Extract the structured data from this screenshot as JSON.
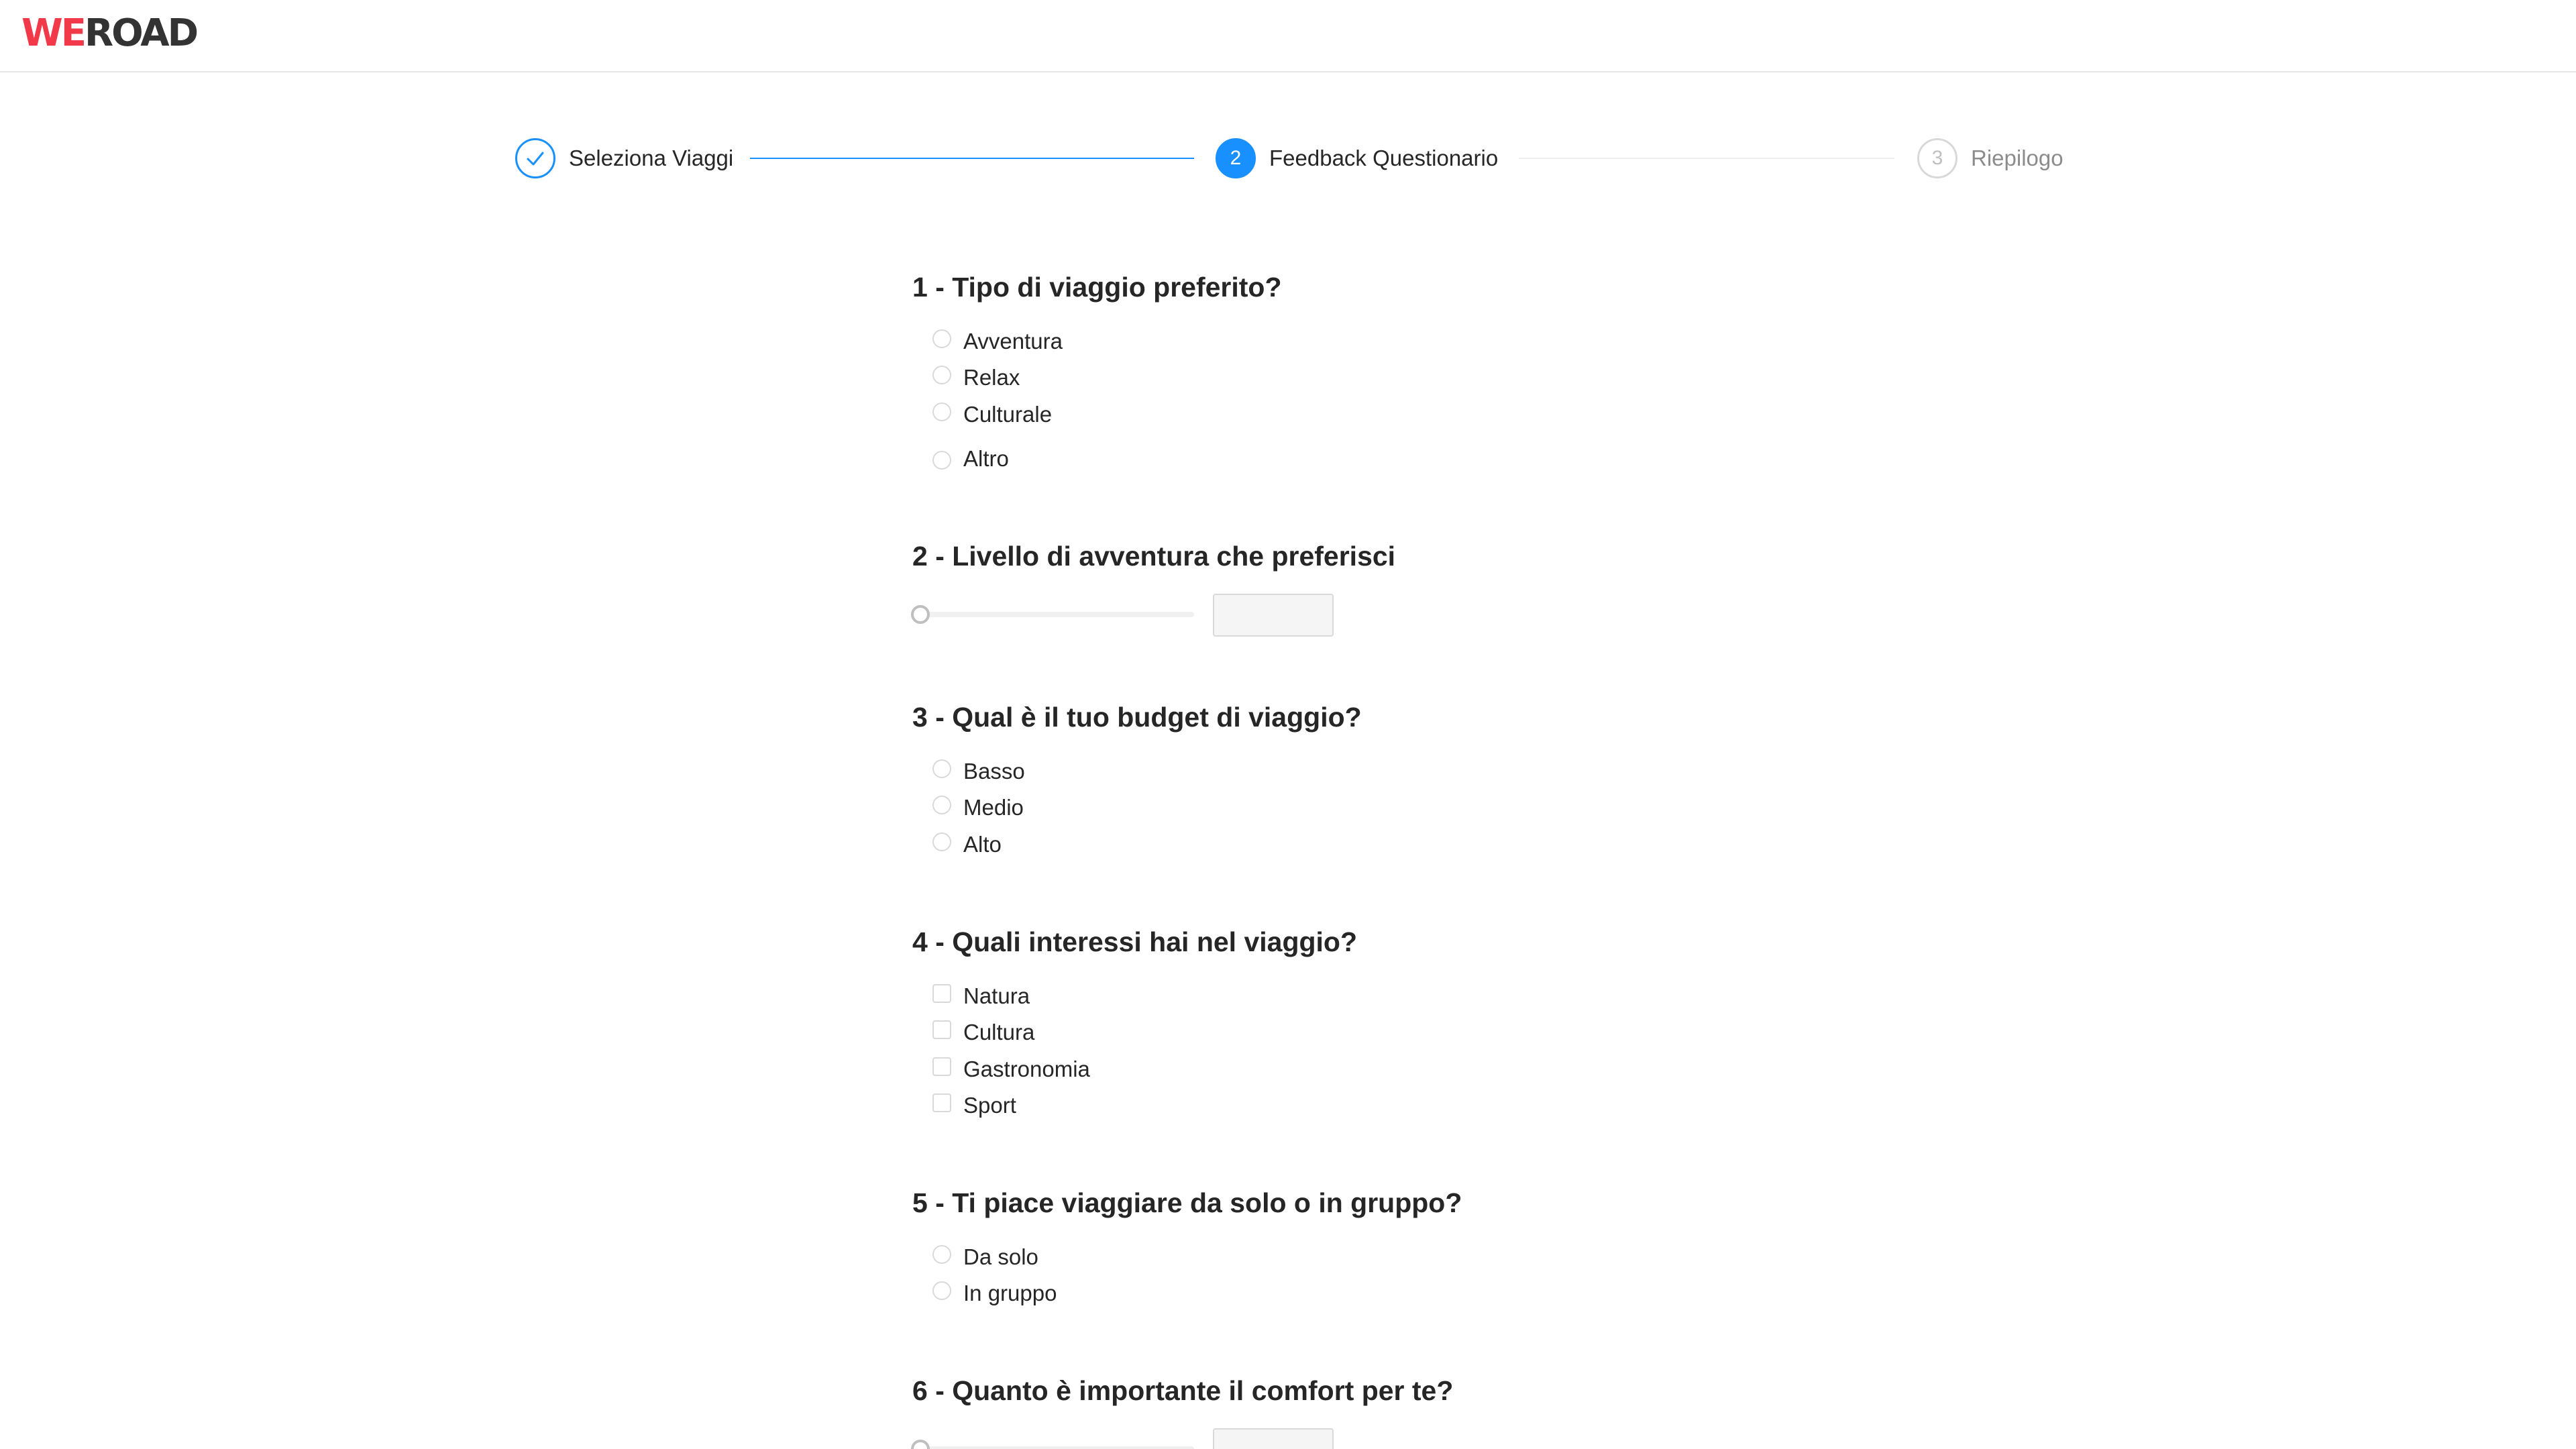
{
  "header": {
    "logo_we": "WE",
    "logo_road": "ROAD"
  },
  "steps": [
    {
      "number": "1",
      "label": "Seleziona Viaggi",
      "status": "done"
    },
    {
      "number": "2",
      "label": "Feedback Questionario",
      "status": "active"
    },
    {
      "number": "3",
      "label": "Riepilogo",
      "status": "wait"
    }
  ],
  "colors": {
    "accent": "#1890ff",
    "brand": "#f2394a"
  },
  "questions": [
    {
      "title": "1 - Tipo di viaggio preferito?",
      "type": "radio",
      "options": [
        "Avventura",
        "Relax",
        "Culturale",
        "Altro"
      ]
    },
    {
      "title": "2 - Livello di avventura che preferisci",
      "type": "slider",
      "value": ""
    },
    {
      "title": "3 - Qual è il tuo budget di viaggio?",
      "type": "radio",
      "options": [
        "Basso",
        "Medio",
        "Alto"
      ]
    },
    {
      "title": "4 - Quali interessi hai nel viaggio?",
      "type": "checkbox",
      "options": [
        "Natura",
        "Cultura",
        "Gastronomia",
        "Sport"
      ]
    },
    {
      "title": "5 - Ti piace viaggiare da solo o in gruppo?",
      "type": "radio",
      "options": [
        "Da solo",
        "In gruppo"
      ]
    },
    {
      "title": "6 - Quanto è importante il comfort per te?",
      "type": "slider",
      "value": ""
    }
  ]
}
